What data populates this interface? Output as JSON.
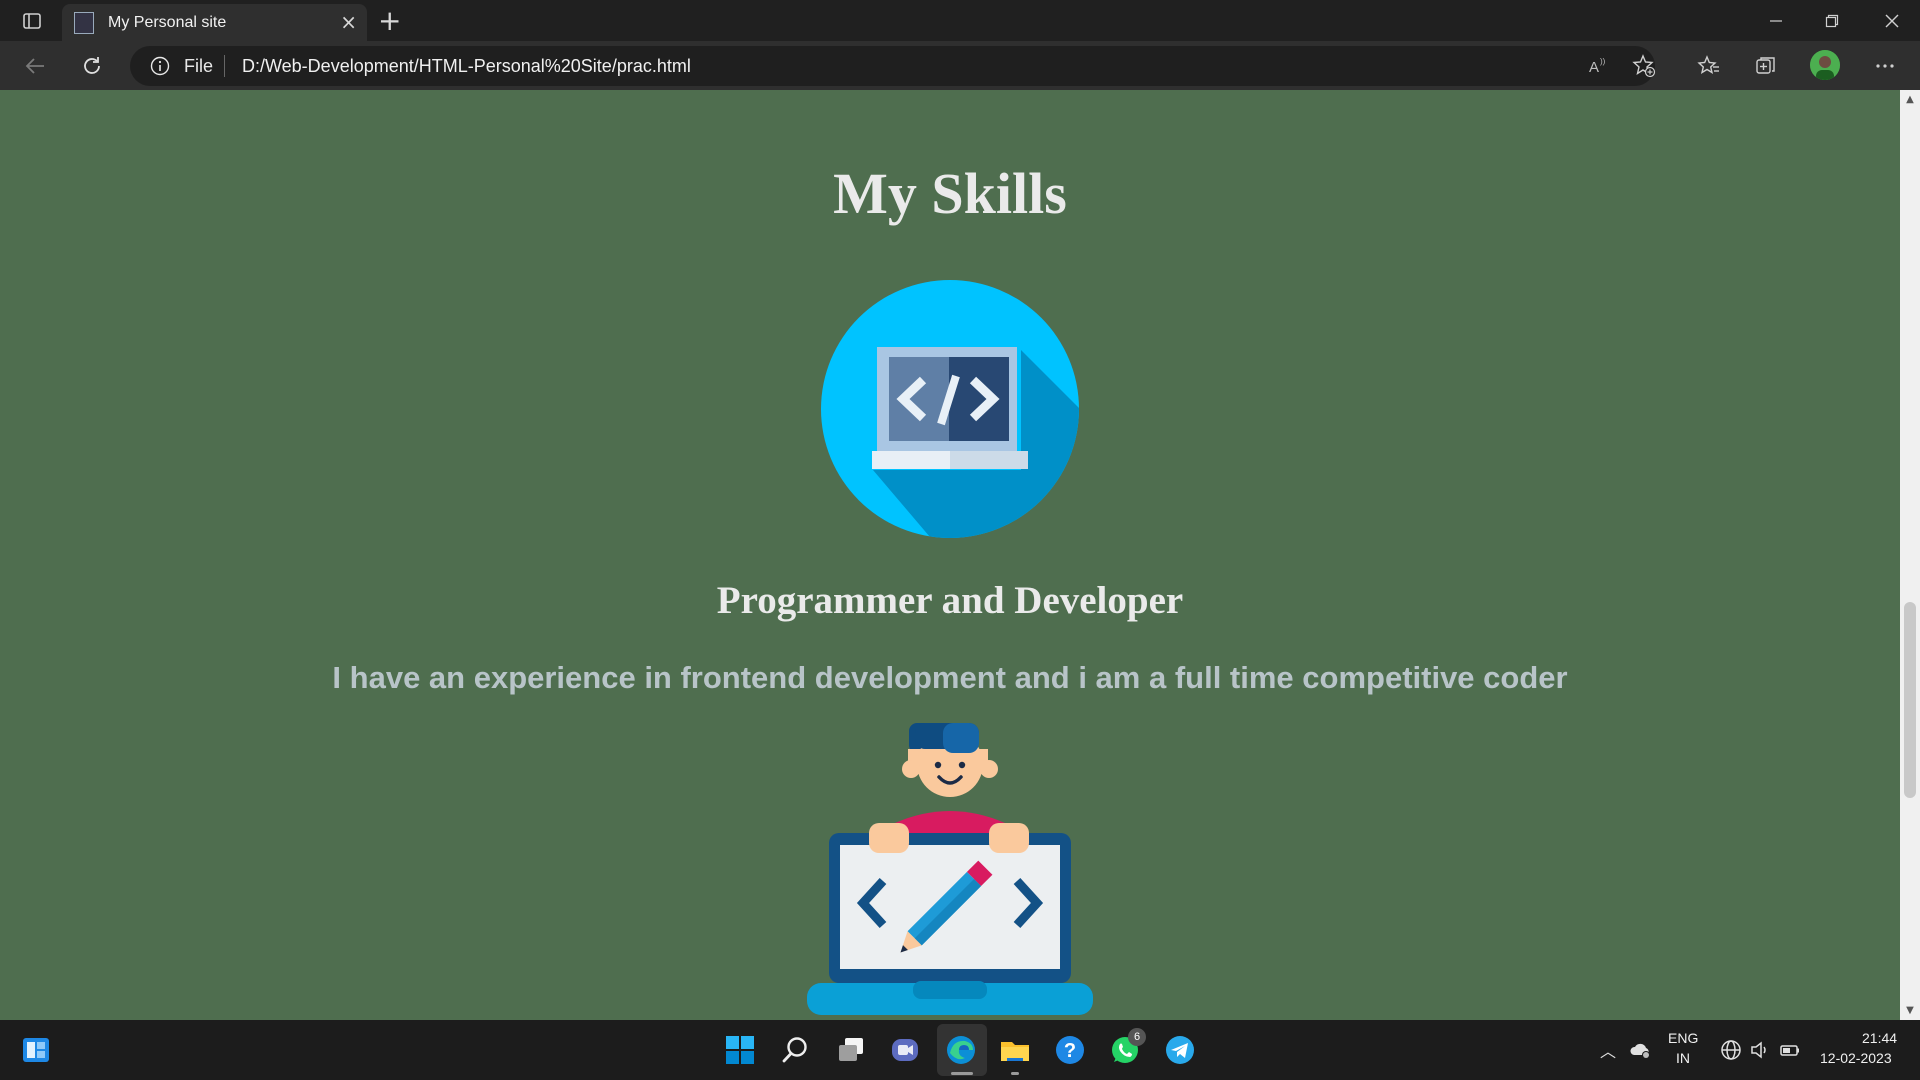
{
  "browser": {
    "tab_title": "My Personal site",
    "address_scheme_label": "File",
    "url": "D:/Web-Development/HTML-Personal%20Site/prac.html"
  },
  "page": {
    "heading": "My Skills",
    "subheading": "Programmer and Developer",
    "paragraph": "I have an experience in frontend development and i am a full time competitive coder",
    "background_color": "#4f6e4f",
    "text_color": "#eaeaea",
    "paragraph_color": "#b8c4c8"
  },
  "taskbar": {
    "whatsapp_badge": "6",
    "language_line1": "ENG",
    "language_line2": "IN",
    "time": "21:44",
    "date": "12-02-2023"
  },
  "icons": [
    "tab-actions-icon",
    "close-icon",
    "plus-icon",
    "back-arrow-icon",
    "refresh-icon",
    "info-icon",
    "read-aloud-icon",
    "add-favorite-icon",
    "favorites-icon",
    "collections-icon",
    "more-icon",
    "windows-start-icon",
    "search-icon",
    "task-view-icon",
    "meet-icon",
    "edge-icon",
    "file-explorer-icon",
    "help-icon",
    "whatsapp-icon",
    "telegram-icon",
    "cloud-icon",
    "network-icon",
    "volume-icon",
    "battery-icon"
  ]
}
